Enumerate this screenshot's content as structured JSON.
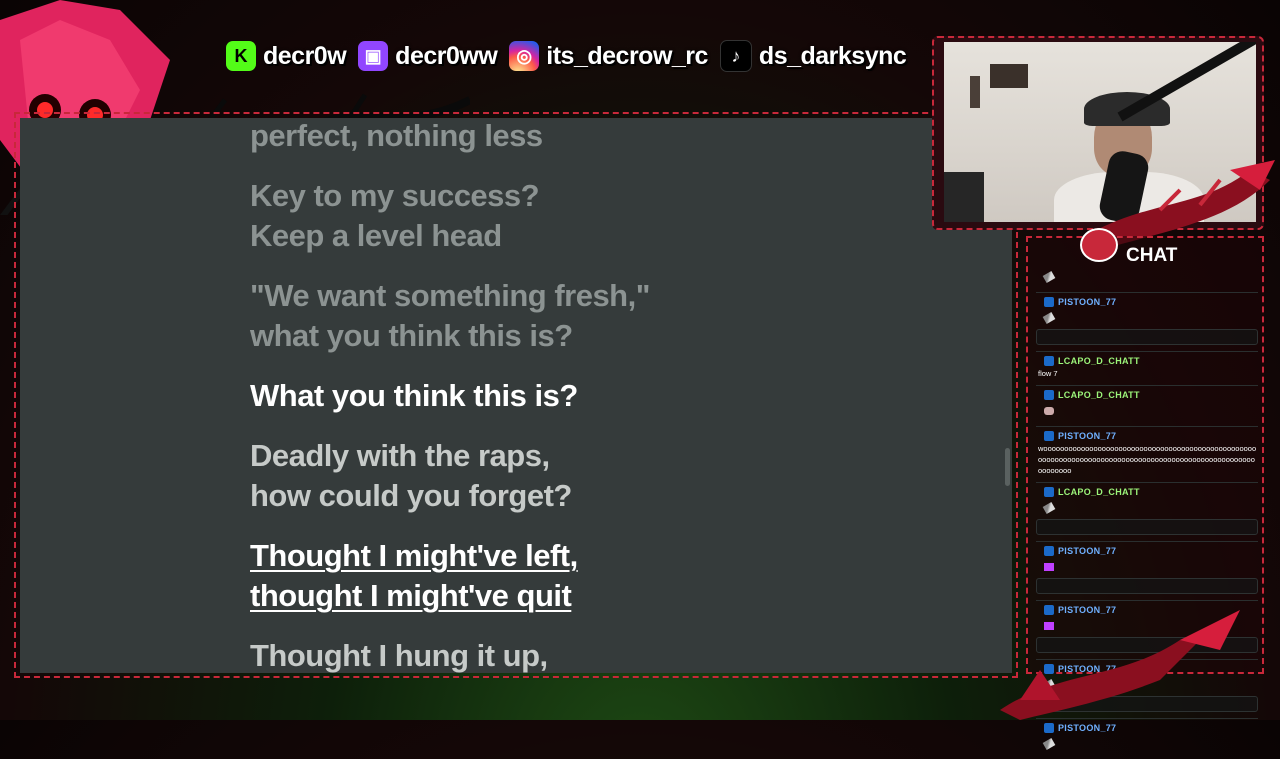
{
  "socials": [
    {
      "platform": "kick",
      "icon": "kick-icon",
      "glyph": "K",
      "handle": "decr0w"
    },
    {
      "platform": "twitch",
      "icon": "twitch-icon",
      "glyph": "▣",
      "handle": "decr0ww"
    },
    {
      "platform": "instagram",
      "icon": "instagram-icon",
      "glyph": "◎",
      "handle": "its_decrow_rc"
    },
    {
      "platform": "tiktok",
      "icon": "tiktok-icon",
      "glyph": "♪",
      "handle": "ds_darksync"
    }
  ],
  "lyrics": {
    "blocks": [
      {
        "state": "past",
        "lines": [
          "perfect, nothing less"
        ]
      },
      {
        "state": "past",
        "lines": [
          "Key to my success?",
          "Keep a level head"
        ]
      },
      {
        "state": "past",
        "lines": [
          "\"We want something fresh,\"",
          "what you think this is?"
        ]
      },
      {
        "state": "active",
        "lines": [
          "What you think this is?"
        ]
      },
      {
        "state": "upcoming",
        "lines": [
          "Deadly with the raps,",
          "how could you forget?"
        ]
      },
      {
        "state": "hover",
        "lines": [
          "Thought I might've left,",
          "thought I might've quit"
        ]
      },
      {
        "state": "upcoming",
        "lines": [
          "Thought I hung it up,"
        ]
      }
    ]
  },
  "chat": {
    "title": "CHAT",
    "messages": [
      {
        "user": "",
        "text": "",
        "emote": "sword"
      },
      {
        "user": "PISTOON_77",
        "user_color": "blue",
        "text": "",
        "emote": "sword"
      },
      {
        "user": "LCAPO_D_CHATT",
        "user_color": "green",
        "text": "flow 7",
        "emote": ""
      },
      {
        "user": "LCAPO_D_CHATT",
        "user_color": "green",
        "text": "",
        "emote": "face"
      },
      {
        "user": "PISTOON_77",
        "user_color": "blue",
        "text": "wooooooooooooooooooooooooooooooooooooooooooooooooooooooooooooooooooooooooooooooooooooooooooooooooooooooooooooooo",
        "emote": ""
      },
      {
        "user": "LCAPO_D_CHATT",
        "user_color": "green",
        "text": "",
        "emote": "sword"
      },
      {
        "user": "PISTOON_77",
        "user_color": "blue",
        "text": "",
        "emote": "purple"
      },
      {
        "user": "PISTOON_77",
        "user_color": "blue",
        "text": "",
        "emote": "purple"
      },
      {
        "user": "PISTOON_77",
        "user_color": "blue",
        "text": "",
        "emote": "sword"
      },
      {
        "user": "PISTOON_77",
        "user_color": "blue",
        "text": "",
        "emote": "sword"
      }
    ]
  },
  "colors": {
    "frame_accent": "#c8283a",
    "lyrics_bg": "#353b3b",
    "lyric_active": "#ffffff",
    "lyric_past": "#8c9392",
    "lyric_upcoming": "#c6cac8"
  }
}
